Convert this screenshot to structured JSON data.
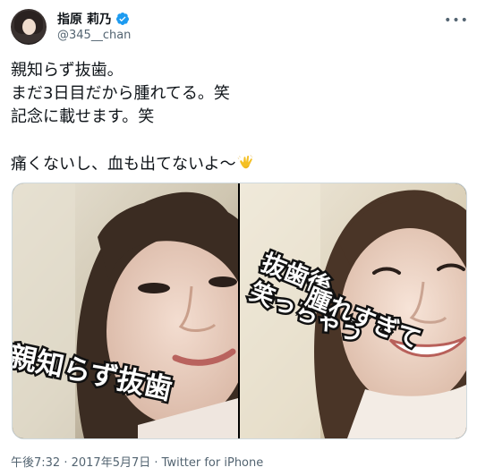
{
  "author": {
    "display_name": "指原 莉乃",
    "handle": "@345__chan",
    "verified": true
  },
  "tweet": {
    "lines": [
      "親知らず抜歯。",
      "まだ3日目だから腫れてる。笑",
      "記念に載せます。笑",
      "",
      "痛くないし、血も出てないよ〜"
    ],
    "emoji": "clapping-hands-icon"
  },
  "media": {
    "left_caption": "親知らず抜歯",
    "right_caption_1": "腫れすぎて",
    "right_caption_2": "抜歯後、",
    "right_caption_3": "笑っちゃう"
  },
  "meta": {
    "time": "午後7:32",
    "sep1": " · ",
    "date": "2017年5月7日",
    "sep2": " · ",
    "source": "Twitter for iPhone"
  },
  "colors": {
    "text": "#0f1419",
    "secondary": "#536471",
    "verified": "#1d9bf0",
    "border": "#cfd9de"
  }
}
